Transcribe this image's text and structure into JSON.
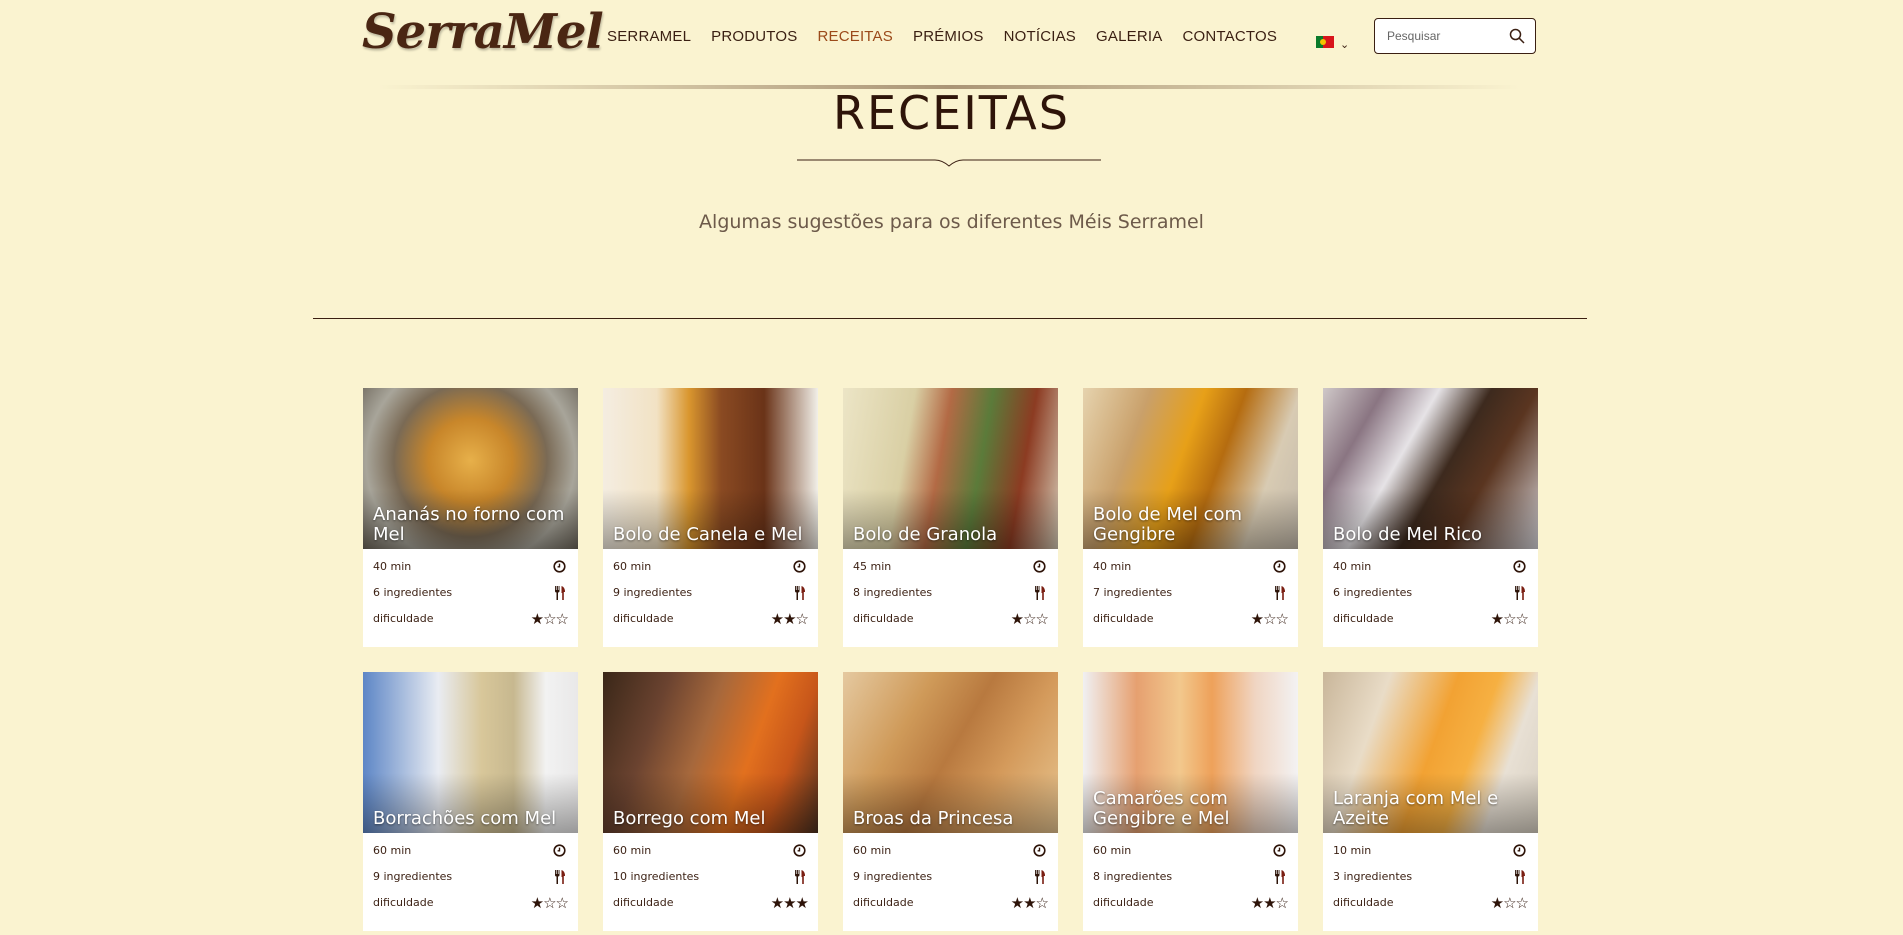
{
  "header": {
    "logo": "SerraMel",
    "nav": [
      {
        "label": "SERRAMEL",
        "active": false
      },
      {
        "label": "PRODUTOS",
        "active": false
      },
      {
        "label": "RECEITAS",
        "active": true
      },
      {
        "label": "PRÉMIOS",
        "active": false
      },
      {
        "label": "NOTÍCIAS",
        "active": false
      },
      {
        "label": "GALERIA",
        "active": false
      },
      {
        "label": "CONTACTOS",
        "active": false
      }
    ],
    "language_icon": "portugal-flag-icon",
    "search": {
      "placeholder": "Pesquisar",
      "value": ""
    }
  },
  "page": {
    "title": "RECEITAS",
    "subtitle": "Algumas sugestões para os diferentes Méis Serramel"
  },
  "difficulty_label": "dificuldade",
  "recipes": [
    {
      "title": "Ananás no forno com Mel",
      "time": "40 min",
      "ingredients": "6 ingredientes",
      "difficulty": 1
    },
    {
      "title": "Bolo de Canela e Mel",
      "time": "60 min",
      "ingredients": "9 ingredientes",
      "difficulty": 2
    },
    {
      "title": "Bolo de Granola",
      "time": "45 min",
      "ingredients": "8 ingredientes",
      "difficulty": 1
    },
    {
      "title": "Bolo de Mel com Gengibre",
      "time": "40 min",
      "ingredients": "7 ingredientes",
      "difficulty": 1
    },
    {
      "title": "Bolo de Mel Rico",
      "time": "40 min",
      "ingredients": "6 ingredientes",
      "difficulty": 1
    },
    {
      "title": "Borrachões com Mel",
      "time": "60 min",
      "ingredients": "9 ingredientes",
      "difficulty": 1
    },
    {
      "title": "Borrego com Mel",
      "time": "60 min",
      "ingredients": "10 ingredientes",
      "difficulty": 3
    },
    {
      "title": "Broas da Princesa",
      "time": "60 min",
      "ingredients": "9 ingredientes",
      "difficulty": 2
    },
    {
      "title": "Camarões com Gengibre e Mel",
      "time": "60 min",
      "ingredients": "8 ingredientes",
      "difficulty": 2
    },
    {
      "title": "Laranja com Mel e Azeite",
      "time": "10 min",
      "ingredients": "3 ingredientes",
      "difficulty": 1
    }
  ],
  "colors": {
    "background": "#faf3d0",
    "text": "#3a1f12",
    "accent": "#9b4a1a"
  }
}
